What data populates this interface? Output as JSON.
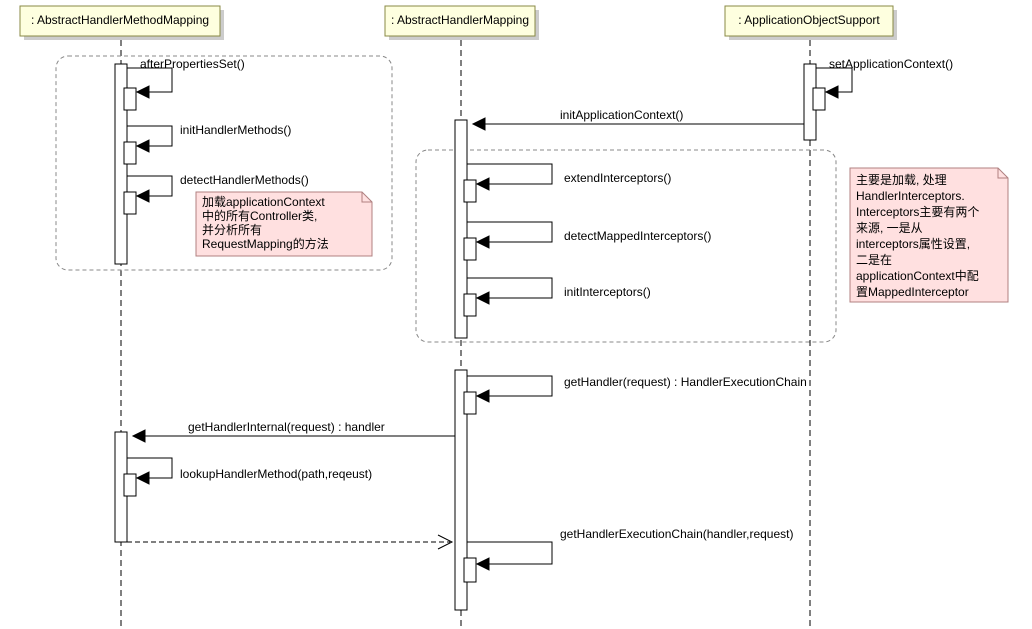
{
  "chart_data": {
    "type": "sequence_diagram",
    "participants": [
      {
        "id": "ahmm",
        "name": ": AbstractHandlerMethodMapping"
      },
      {
        "id": "ahm",
        "name": ": AbstractHandlerMapping"
      },
      {
        "id": "aos",
        "name": ": ApplicationObjectSupport"
      }
    ],
    "messages": [
      {
        "from": "ahmm",
        "to": "ahmm",
        "label": "afterPropertiesSet()",
        "type": "self"
      },
      {
        "from": "aos",
        "to": "aos",
        "label": "setApplicationContext()",
        "type": "self"
      },
      {
        "from": "ahmm",
        "to": "ahmm",
        "label": "initHandlerMethods()",
        "type": "self"
      },
      {
        "from": "aos",
        "to": "ahm",
        "label": "initApplicationContext()",
        "type": "call"
      },
      {
        "from": "ahmm",
        "to": "ahmm",
        "label": "detectHandlerMethods()",
        "type": "self"
      },
      {
        "from": "ahm",
        "to": "ahm",
        "label": "extendInterceptors()",
        "type": "self"
      },
      {
        "from": "ahm",
        "to": "ahm",
        "label": "detectMappedInterceptors()",
        "type": "self"
      },
      {
        "from": "ahm",
        "to": "ahm",
        "label": "initInterceptors()",
        "type": "self"
      },
      {
        "from": "ahm",
        "to": "ahm",
        "label": "getHandler(request) : HandlerExecutionChain",
        "type": "self"
      },
      {
        "from": "ahm",
        "to": "ahmm",
        "label": "getHandlerInternal(request) : handler",
        "type": "call"
      },
      {
        "from": "ahmm",
        "to": "ahmm",
        "label": "lookupHandlerMethod(path,reqeust)",
        "type": "self"
      },
      {
        "from": "ahmm",
        "to": "ahm",
        "label": "getHandlerExecutionChain(handler,request)",
        "type": "return"
      }
    ],
    "notes": [
      {
        "attached_to": "detectHandlerMethods()",
        "lines": [
          "加载applicationContext",
          "中的所有Controller类,",
          "并分析所有",
          "RequestMapping的方法"
        ]
      },
      {
        "attached_to": "initApplicationContext()",
        "lines": [
          "主要是加载, 处理",
          "HandlerInterceptors.",
          "Interceptors主要有两个",
          "来源, 一是从",
          "interceptors属性设置,",
          "二是在",
          "applicationContext中配",
          "置MappedInterceptor"
        ]
      }
    ],
    "frames": [
      {
        "around": [
          "afterPropertiesSet()",
          "initHandlerMethods()",
          "detectHandlerMethods()"
        ]
      },
      {
        "around": [
          "extendInterceptors()",
          "detectMappedInterceptors()",
          "initInterceptors()"
        ]
      }
    ]
  },
  "participants": {
    "ahmm": ": AbstractHandlerMethodMapping",
    "ahm": ": AbstractHandlerMapping",
    "aos": ": ApplicationObjectSupport"
  },
  "messages": {
    "afterPropertiesSet": "afterPropertiesSet()",
    "setApplicationContext": "setApplicationContext()",
    "initHandlerMethods": "initHandlerMethods()",
    "initApplicationContext": "initApplicationContext()",
    "detectHandlerMethods": "detectHandlerMethods()",
    "extendInterceptors": "extendInterceptors()",
    "detectMappedInterceptors": "detectMappedInterceptors()",
    "initInterceptors": "initInterceptors()",
    "getHandler": "getHandler(request) : HandlerExecutionChain",
    "getHandlerInternal": "getHandlerInternal(request) : handler",
    "lookupHandlerMethod": "lookupHandlerMethod(path,reqeust)",
    "getHandlerExecutionChain": "getHandlerExecutionChain(handler,request)"
  },
  "note1": {
    "l1": "加载applicationContext",
    "l2": "中的所有Controller类,",
    "l3": "并分析所有",
    "l4": "RequestMapping的方法"
  },
  "note2": {
    "l1": "主要是加载, 处理",
    "l2": "HandlerInterceptors.",
    "l3": "Interceptors主要有两个",
    "l4": "来源, 一是从",
    "l5": "interceptors属性设置,",
    "l6": "二是在",
    "l7": "applicationContext中配",
    "l8": "置MappedInterceptor"
  }
}
